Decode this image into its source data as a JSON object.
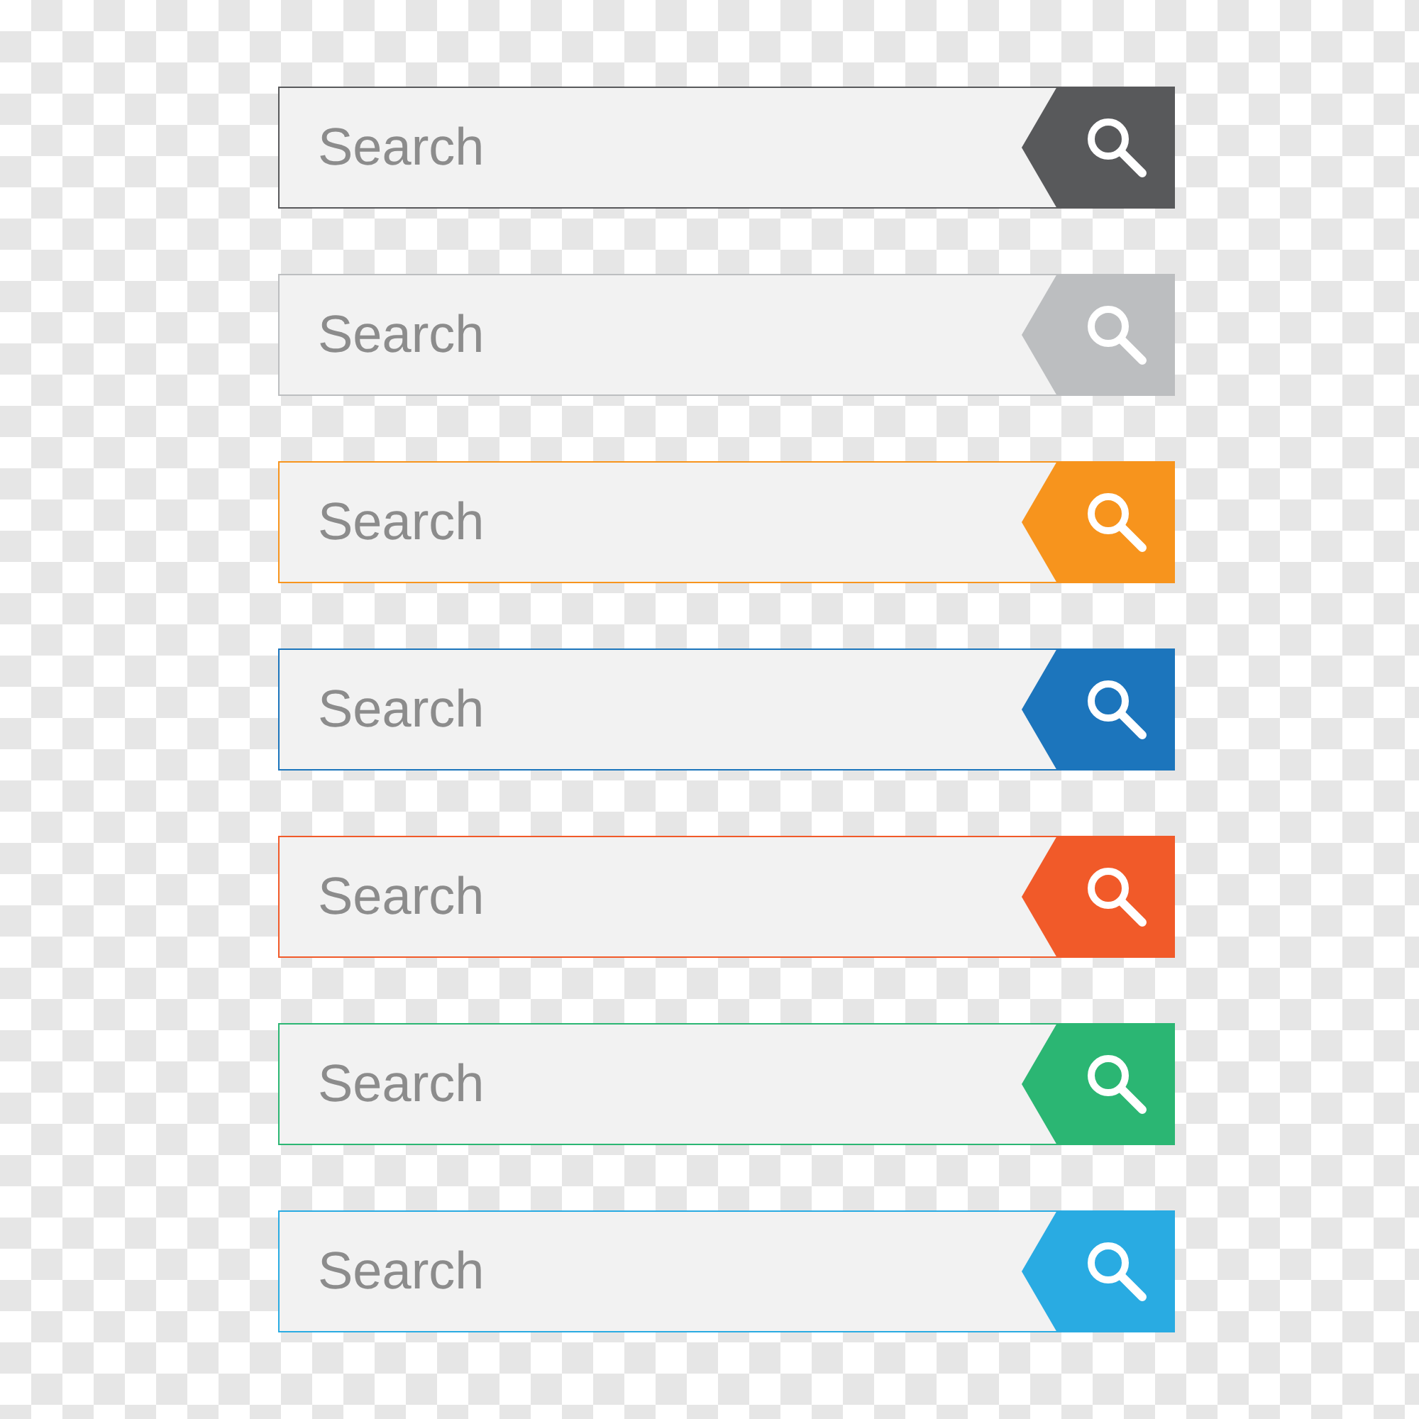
{
  "search_bars": [
    {
      "placeholder": "Search",
      "color": "#58595b"
    },
    {
      "placeholder": "Search",
      "color": "#bcbec0"
    },
    {
      "placeholder": "Search",
      "color": "#f7941d"
    },
    {
      "placeholder": "Search",
      "color": "#1c75bc"
    },
    {
      "placeholder": "Search",
      "color": "#f15a29"
    },
    {
      "placeholder": "Search",
      "color": "#2bb673"
    },
    {
      "placeholder": "Search",
      "color": "#29abe2"
    }
  ]
}
